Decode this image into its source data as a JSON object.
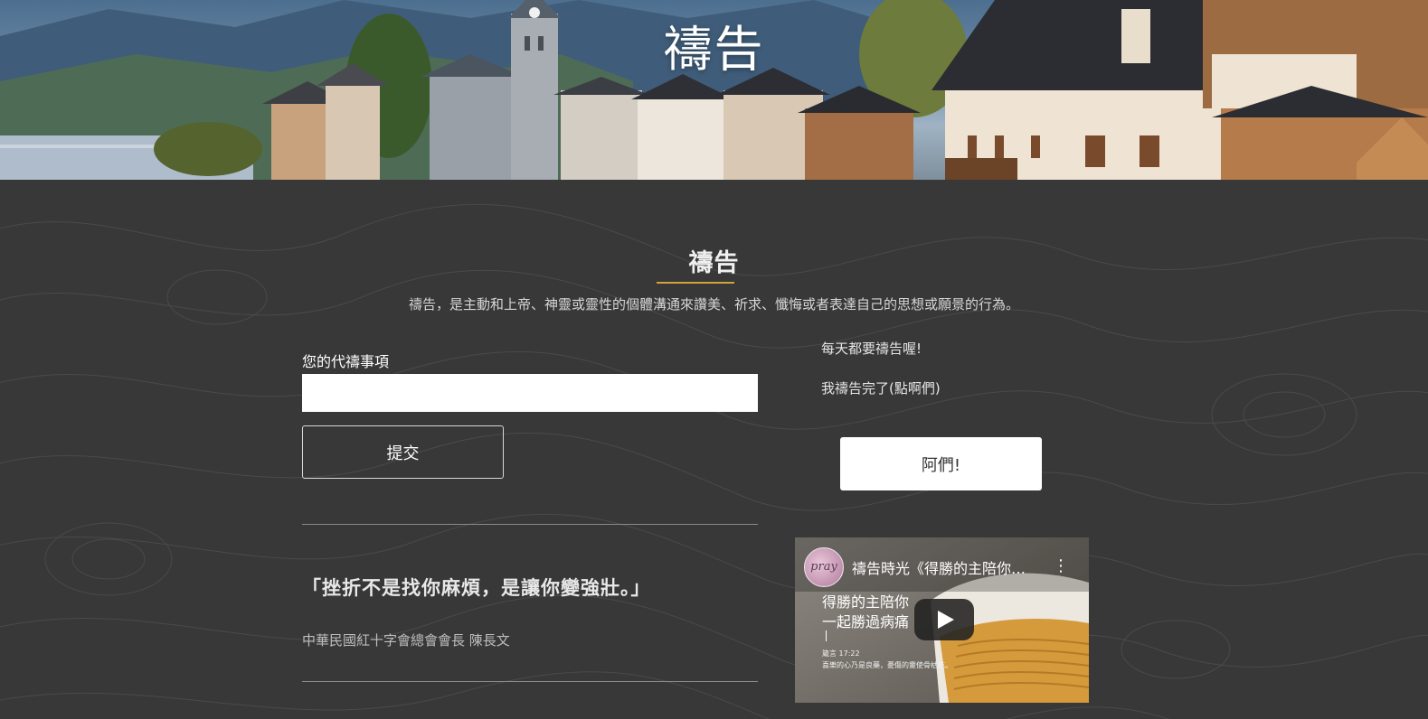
{
  "hero": {
    "title": "禱告"
  },
  "section": {
    "title": "禱告",
    "intro": "禱告，是主動和上帝、神靈或靈性的個體溝通來讚美、祈求、懺悔或者表達自己的思想或願景的行為。",
    "accent_color": "#d4a23a"
  },
  "form": {
    "label": "您的代禱事項",
    "input_value": "",
    "input_placeholder": "",
    "submit_label": "提交"
  },
  "daily": {
    "reminder": "每天都要禱告喔!",
    "done_prompt": "我禱告完了(點啊們)",
    "amen_label": "阿們!"
  },
  "quote": {
    "text": "「挫折不是找你麻煩，是讓你變強壯。」",
    "attribution": "中華民國紅十字會總會會長 陳長文"
  },
  "video": {
    "channel_avatar_text": "pray",
    "title": "禱告時光《得勝的主陪你一起勝過病痛》",
    "thumb_line1": "得勝的主陪你",
    "thumb_line2": "一起勝過病痛",
    "thumb_verse_ref": "箴言 17:22",
    "thumb_verse": "喜樂的心乃是良藥，憂傷的靈使骨枯乾。",
    "menu_icon": "kebab-menu-icon",
    "play_icon": "play-icon"
  },
  "colors": {
    "background": "#383838",
    "button_white": "#ffffff",
    "text_light": "#e6e6e6"
  }
}
